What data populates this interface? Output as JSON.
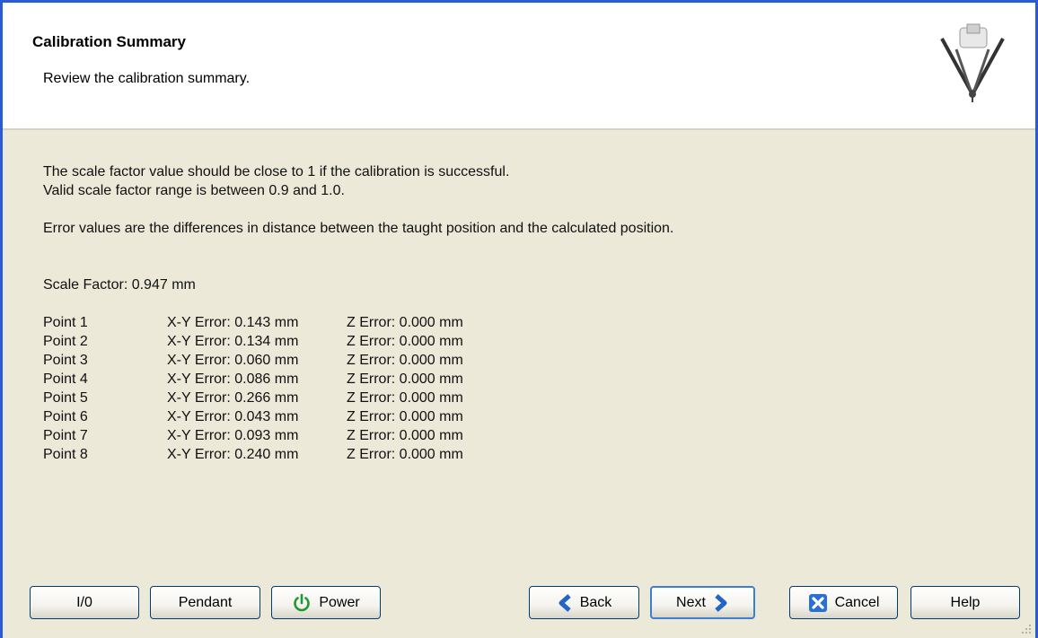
{
  "header": {
    "title": "Calibration Summary",
    "subtitle": "Review the calibration summary."
  },
  "icons": {
    "header_logo": "delta-robot-icon"
  },
  "content": {
    "line1": "The scale factor value should be close to 1 if the calibration is successful.",
    "line2": "Valid scale factor range is between 0.9 and 1.0.",
    "line3": "Error values are the differences in distance between the taught position and the calculated position.",
    "scale_factor": "Scale Factor: 0.947 mm"
  },
  "points": [
    {
      "name": "Point 1",
      "xy": "X-Y Error: 0.143 mm",
      "z": "Z Error: 0.000 mm"
    },
    {
      "name": "Point 2",
      "xy": "X-Y Error: 0.134 mm",
      "z": "Z Error: 0.000 mm"
    },
    {
      "name": "Point 3",
      "xy": "X-Y Error: 0.060 mm",
      "z": "Z Error: 0.000 mm"
    },
    {
      "name": "Point 4",
      "xy": "X-Y Error: 0.086 mm",
      "z": "Z Error: 0.000 mm"
    },
    {
      "name": "Point 5",
      "xy": "X-Y Error: 0.266 mm",
      "z": "Z Error: 0.000 mm"
    },
    {
      "name": "Point 6",
      "xy": "X-Y Error: 0.043 mm",
      "z": "Z Error: 0.000 mm"
    },
    {
      "name": "Point 7",
      "xy": "X-Y Error: 0.093 mm",
      "z": "Z Error: 0.000 mm"
    },
    {
      "name": "Point 8",
      "xy": "X-Y Error: 0.240 mm",
      "z": "Z Error: 0.000 mm"
    }
  ],
  "buttons": {
    "io": "I/0",
    "pendant": "Pendant",
    "power": "Power",
    "back": "Back",
    "next": "Next",
    "cancel": "Cancel",
    "help": "Help"
  },
  "colors": {
    "window_border": "#2a5bd7",
    "dialog_background": "#ece9d8",
    "power_icon": "#1f9a2e",
    "arrow_icon": "#2463c7",
    "cancel_icon": "#2a6fd6"
  }
}
